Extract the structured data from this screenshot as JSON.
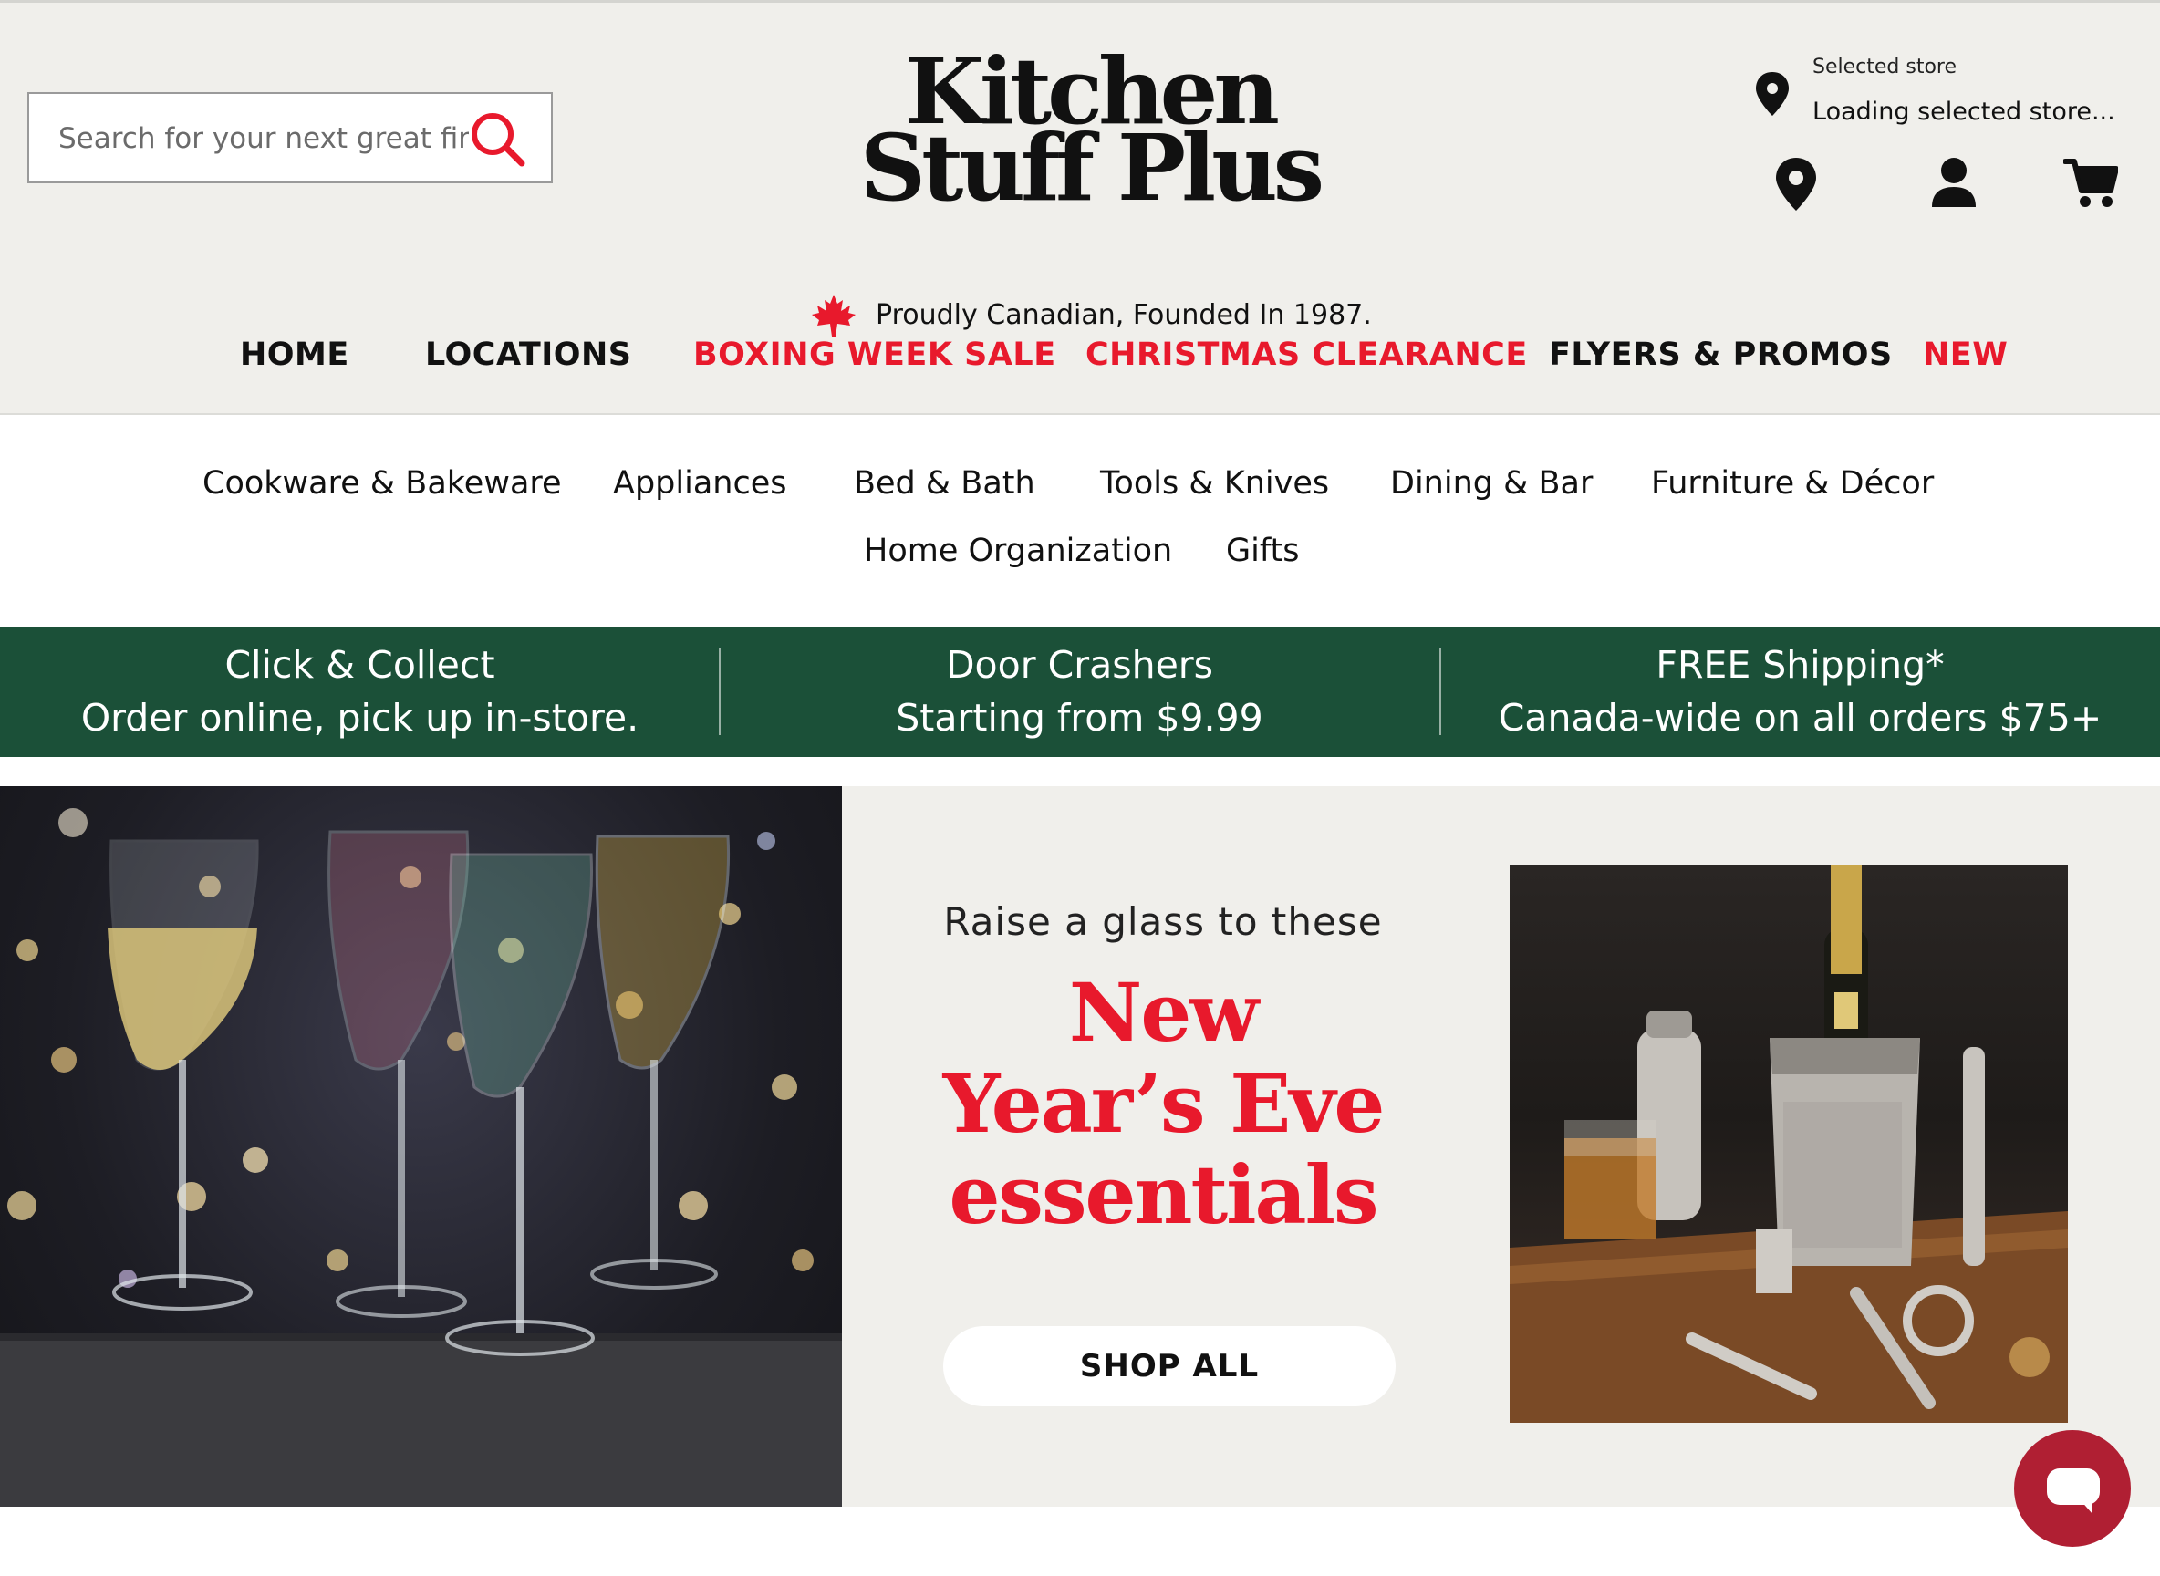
{
  "header": {
    "search_placeholder": "Search for your next great find",
    "logo_line1": "Kitchen",
    "logo_line2": "Stuff Plus",
    "store_label": "Selected store",
    "store_status": "Loading selected store...",
    "tagline": "Proudly Canadian, Founded In 1987."
  },
  "main_nav": [
    {
      "label": "HOME"
    },
    {
      "label": "LOCATIONS"
    },
    {
      "label": "BOXING WEEK SALE"
    },
    {
      "label": "CHRISTMAS CLEARANCE"
    },
    {
      "label": "FLYERS & PROMOS"
    },
    {
      "label": "NEW"
    }
  ],
  "categories": [
    {
      "label": "Cookware & Bakeware"
    },
    {
      "label": "Appliances"
    },
    {
      "label": "Bed & Bath"
    },
    {
      "label": "Tools & Knives"
    },
    {
      "label": "Dining & Bar"
    },
    {
      "label": "Furniture & Décor"
    },
    {
      "label": "Home Organization"
    },
    {
      "label": "Gifts"
    }
  ],
  "promo_bar": [
    {
      "title": "Click & Collect",
      "subtitle": "Order online, pick up in-store."
    },
    {
      "title": "Door Crashers",
      "subtitle": "Starting from $9.99"
    },
    {
      "title": "FREE Shipping*",
      "subtitle": "Canada-wide on all orders $75+"
    }
  ],
  "hero": {
    "intro": "Raise a glass to these",
    "headline_line1": "New",
    "headline_line2": "Year’s  Eve",
    "headline_line3": "essentials",
    "cta": "SHOP ALL"
  },
  "colors": {
    "accent_red": "#e8192c",
    "promo_green": "#1b5038",
    "header_bg": "#f0efeb",
    "chat_red": "#b01f33"
  },
  "icons": {
    "search": "search-icon",
    "store": "location-pin-icon",
    "account": "user-icon",
    "cart": "cart-icon",
    "chat": "chat-icon"
  }
}
